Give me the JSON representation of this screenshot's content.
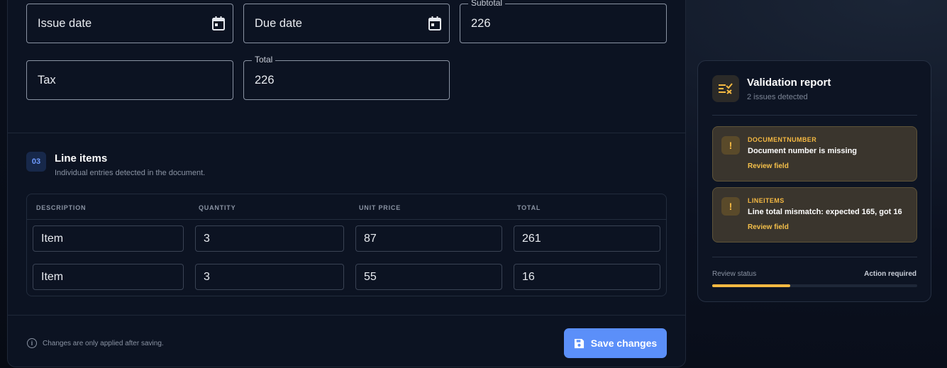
{
  "form": {
    "issue_date": {
      "placeholder": "Issue date"
    },
    "due_date": {
      "placeholder": "Due date"
    },
    "subtotal": {
      "label": "Subtotal",
      "value": "226"
    },
    "tax": {
      "placeholder": "Tax"
    },
    "total": {
      "label": "Total",
      "value": "226"
    }
  },
  "line_items": {
    "number": "03",
    "title": "Line items",
    "subtitle": "Individual entries detected in the document.",
    "columns": [
      "DESCRIPTION",
      "QUANTITY",
      "UNIT PRICE",
      "TOTAL"
    ],
    "rows": [
      {
        "description": "Item",
        "quantity": "3",
        "unit_price": "87",
        "total": "261"
      },
      {
        "description": "Item",
        "quantity": "3",
        "unit_price": "55",
        "total": "16"
      }
    ]
  },
  "footer": {
    "note": "Changes are only applied after saving.",
    "save_label": "Save changes"
  },
  "report": {
    "title": "Validation report",
    "subtitle": "2 issues detected",
    "issues": [
      {
        "code": "DOCUMENTNUMBER",
        "message": "Document number is missing",
        "link": "Review field"
      },
      {
        "code": "LINEITEMS",
        "message": "Line total mismatch: expected 165, got 16",
        "link": "Review field"
      }
    ],
    "status_label": "Review status",
    "status_value": "Action required",
    "progress": 0.38
  },
  "colors": {
    "accent": "#5b8ff9",
    "warning": "#f5b942",
    "background": "#0c1322"
  },
  "icons": {
    "date": "calendar-icon",
    "save": "floppy-disk-icon",
    "info": "info-icon",
    "warning": "exclamation-icon",
    "report": "checklist-icon"
  }
}
